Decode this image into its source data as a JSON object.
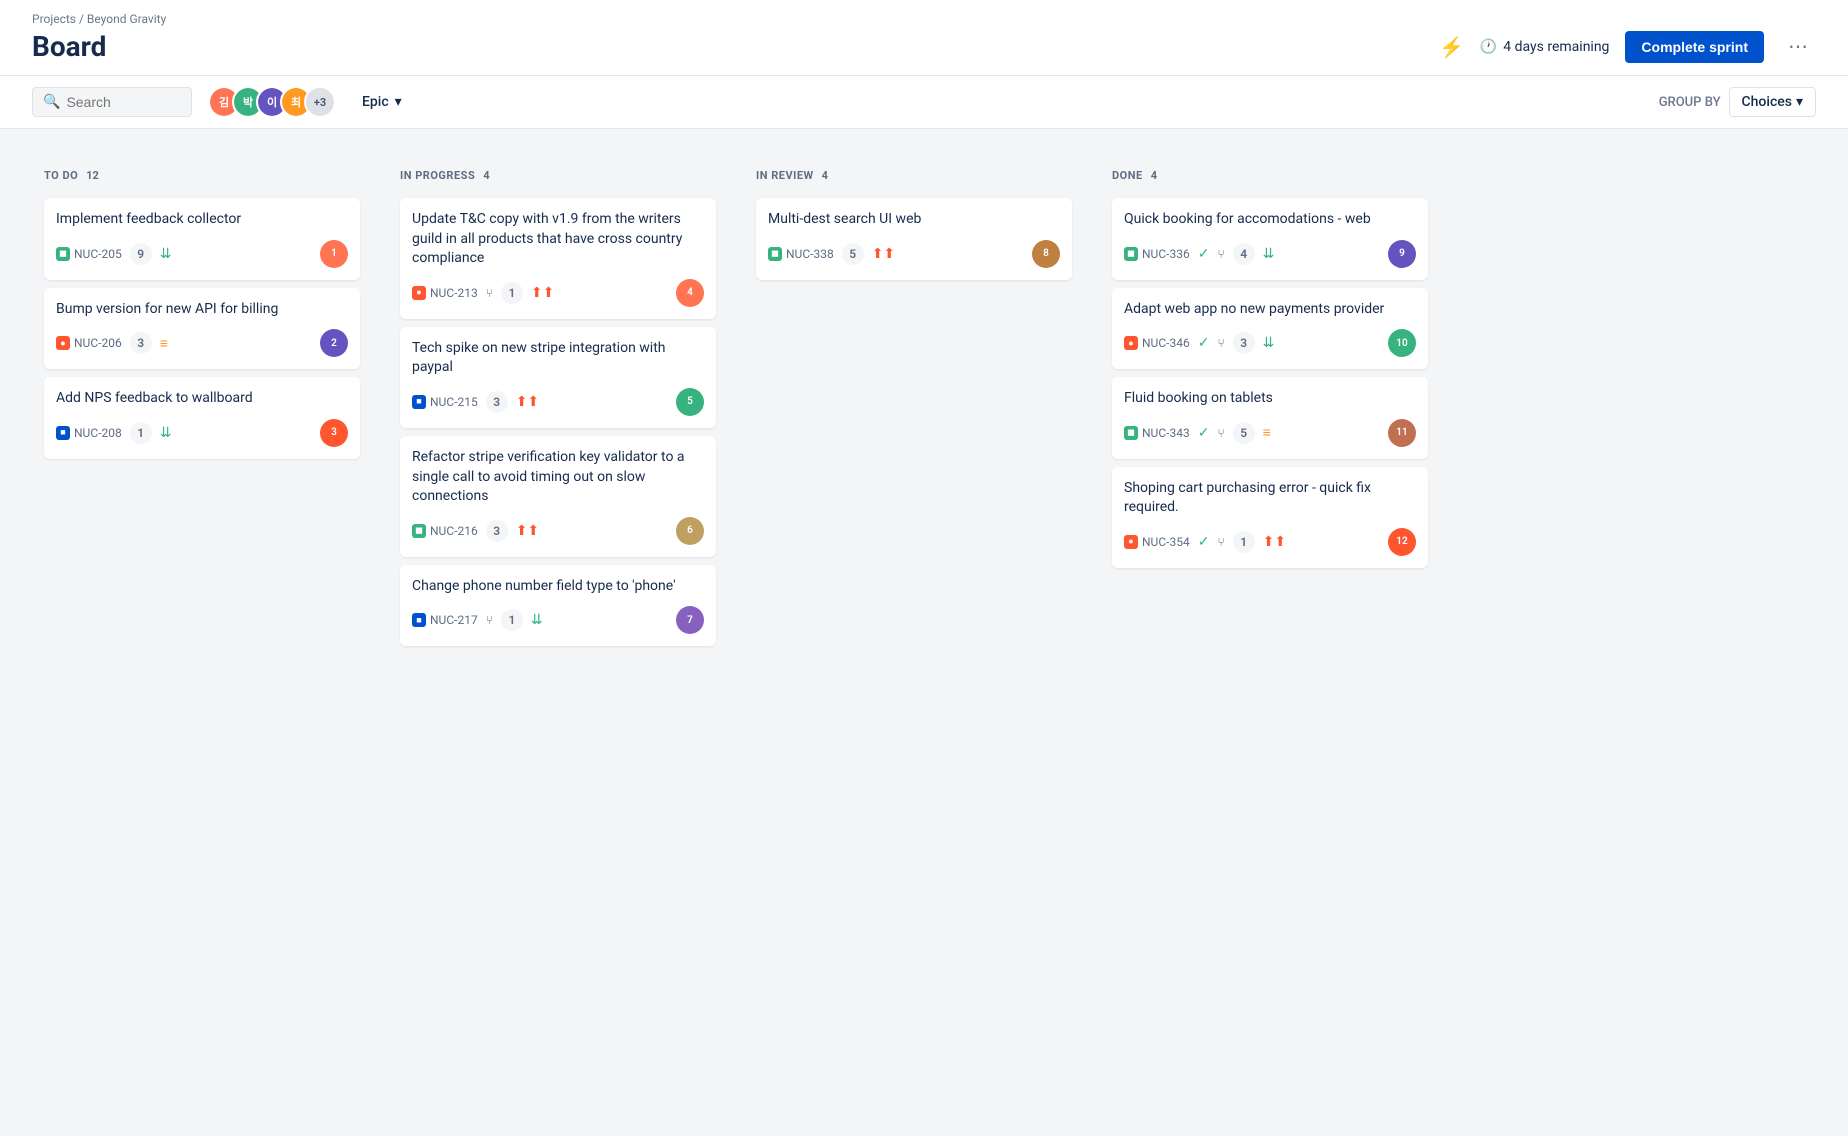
{
  "breadcrumb": "Projects / Beyond Gravity",
  "page_title": "Board",
  "header": {
    "days_remaining": "4 days remaining",
    "complete_sprint": "Complete sprint",
    "more_icon": "⋯"
  },
  "toolbar": {
    "search_placeholder": "Search",
    "epic_filter": "Epic",
    "group_by_label": "GROUP BY",
    "choices_label": "Choices",
    "plus_count": "+3"
  },
  "columns": [
    {
      "id": "todo",
      "title": "TO DO",
      "count": 12,
      "cards": [
        {
          "id": "c1",
          "title": "Implement feedback collector",
          "issue_id": "NUC-205",
          "issue_type": "story",
          "points": 9,
          "priority": "low",
          "priority_symbol": "▾",
          "assignee": "A1",
          "assignee_color": "#ff7452"
        },
        {
          "id": "c2",
          "title": "Bump version for new API for billing",
          "issue_id": "NUC-206",
          "issue_type": "bug",
          "points": 3,
          "priority": "medium",
          "priority_symbol": "═",
          "assignee": "A2",
          "assignee_color": "#6554c0"
        },
        {
          "id": "c3",
          "title": "Add NPS feedback to wallboard",
          "issue_id": "NUC-208",
          "issue_type": "task",
          "points": 1,
          "priority": "low",
          "priority_symbol": "≫",
          "assignee": "A3",
          "assignee_color": "#ff5630"
        }
      ]
    },
    {
      "id": "inprogress",
      "title": "IN PROGRESS",
      "count": 4,
      "cards": [
        {
          "id": "c4",
          "title": "Update T&C copy with v1.9 from the writers guild in all products that have cross country compliance",
          "issue_id": "NUC-213",
          "issue_type": "bug",
          "points": 1,
          "branch_count": 1,
          "priority": "high",
          "priority_symbol": "▲▲",
          "assignee": "A4",
          "assignee_color": "#ff7452"
        },
        {
          "id": "c5",
          "title": "Tech spike on new stripe integration with paypal",
          "issue_id": "NUC-215",
          "issue_type": "task",
          "points": 3,
          "priority": "high",
          "priority_symbol": "▲▲",
          "assignee": "A5",
          "assignee_color": "#36b37e"
        },
        {
          "id": "c6",
          "title": "Refactor stripe verification key validator to a single call to avoid timing out on slow connections",
          "issue_id": "NUC-216",
          "issue_type": "story",
          "points": 3,
          "priority": "high",
          "priority_symbol": "▲▲",
          "assignee": "A6",
          "assignee_color": "#c0a060"
        },
        {
          "id": "c7",
          "title": "Change phone number field type to 'phone'",
          "issue_id": "NUC-217",
          "issue_type": "task",
          "points": 1,
          "branch_count": 1,
          "priority": "low",
          "priority_symbol": "≫",
          "assignee": "A7",
          "assignee_color": "#8860c0"
        }
      ]
    },
    {
      "id": "inreview",
      "title": "IN REVIEW",
      "count": 4,
      "cards": [
        {
          "id": "c8",
          "title": "Multi-dest search UI web",
          "issue_id": "NUC-338",
          "issue_type": "story",
          "points": 5,
          "priority": "high",
          "priority_symbol": "▲",
          "assignee": "A8",
          "assignee_color": "#c08040"
        }
      ]
    },
    {
      "id": "done",
      "title": "DONE",
      "count": 4,
      "cards": [
        {
          "id": "c9",
          "title": "Quick booking for accomodations - web",
          "issue_id": "NUC-336",
          "issue_type": "story",
          "check": true,
          "branch_count": 4,
          "priority": "low",
          "priority_symbol": "≫",
          "assignee": "A9",
          "assignee_color": "#6554c0"
        },
        {
          "id": "c10",
          "title": "Adapt web app no new payments provider",
          "issue_id": "NUC-346",
          "issue_type": "bug",
          "check": true,
          "branch_count": 3,
          "priority": "low",
          "priority_symbol": "▾",
          "assignee": "A10",
          "assignee_color": "#36b37e"
        },
        {
          "id": "c11",
          "title": "Fluid booking on tablets",
          "issue_id": "NUC-343",
          "issue_type": "story",
          "check": true,
          "branch_count": 5,
          "priority": "medium",
          "priority_symbol": "═",
          "assignee": "A11",
          "assignee_color": "#c07050"
        },
        {
          "id": "c12",
          "title": "Shoping cart purchasing error - quick fix required.",
          "issue_id": "NUC-354",
          "issue_type": "bug",
          "check": true,
          "branch_count": 1,
          "priority": "critical",
          "priority_symbol": "▲▲",
          "assignee": "A12",
          "assignee_color": "#ff5630"
        }
      ]
    }
  ]
}
